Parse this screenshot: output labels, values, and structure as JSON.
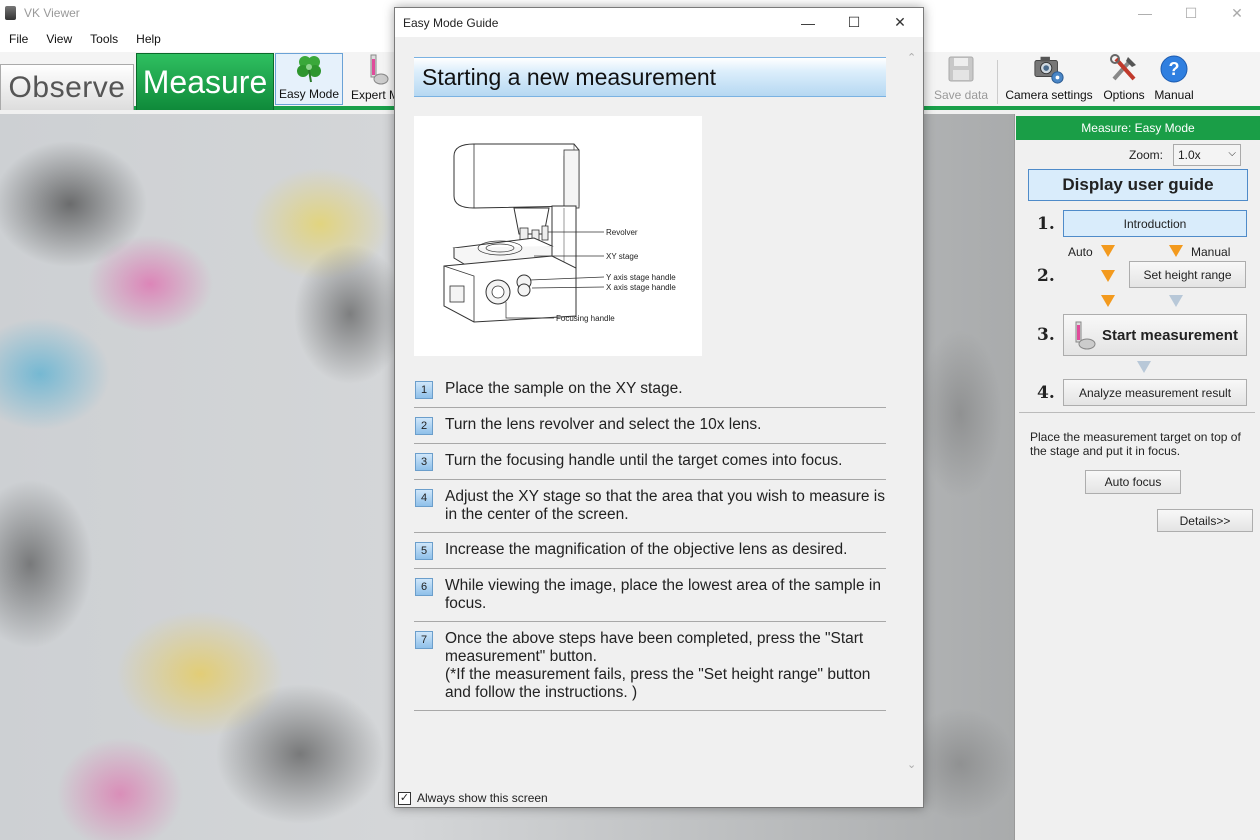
{
  "app": {
    "title": "VK Viewer",
    "window_min": "—",
    "window_max": "☐",
    "window_close": "✕"
  },
  "menu": {
    "items": [
      "File",
      "View",
      "Tools",
      "Help"
    ]
  },
  "toolbar": {
    "observe_tab": "Observe",
    "measure_tab": "Measure",
    "easy_mode": "Easy Mode",
    "expert_mode": "Expert M",
    "save_data": "Save data",
    "camera_settings": "Camera settings",
    "options": "Options",
    "manual": "Manual"
  },
  "panel": {
    "header": "Measure: Easy Mode",
    "zoom_label": "Zoom:",
    "zoom_value": "1.0x",
    "display_user_guide": "Display user guide",
    "step1_num": "1.",
    "step2_num": "2.",
    "step3_num": "3.",
    "step4_num": "4.",
    "introduction": "Introduction",
    "auto_label": "Auto",
    "manual_label": "Manual",
    "set_height_range": "Set height range",
    "start_measurement": "Start measurement",
    "analyze_result": "Analyze measurement result",
    "description": "Place the measurement target on top of the stage and put it in focus.",
    "auto_focus": "Auto focus",
    "details": "Details>>"
  },
  "dialog": {
    "title": "Easy Mode Guide",
    "heading": "Starting a new measurement",
    "callouts": {
      "revolver": "Revolver",
      "xy_stage": "XY stage",
      "y_handle": "Y axis stage handle",
      "x_handle": "X axis stage handle",
      "focus_handle": "Focusing handle"
    },
    "steps": [
      {
        "num": "1",
        "text": "Place the sample on the XY stage."
      },
      {
        "num": "2",
        "text": "Turn the lens revolver and select the 10x lens."
      },
      {
        "num": "3",
        "text": "Turn the focusing handle until the target comes into focus."
      },
      {
        "num": "4",
        "text": "Adjust the XY stage so that the area that you wish to measure is in the center of the screen."
      },
      {
        "num": "5",
        "text": "Increase the magnification of the objective lens as desired."
      },
      {
        "num": "6",
        "text": "While viewing the image, place the lowest area of the sample in focus."
      },
      {
        "num": "7",
        "text": "Once the above steps have been completed, press the \"Start measurement\" button.",
        "note": "(*If the measurement fails, press the \"Set height range\" button and follow the instructions. )"
      }
    ],
    "always_show": "Always show this screen",
    "always_show_checked": true
  },
  "colors": {
    "accent_green": "#1a9e47",
    "selected_blue": "#d9ecfb",
    "arrow_orange": "#f39a1e"
  }
}
